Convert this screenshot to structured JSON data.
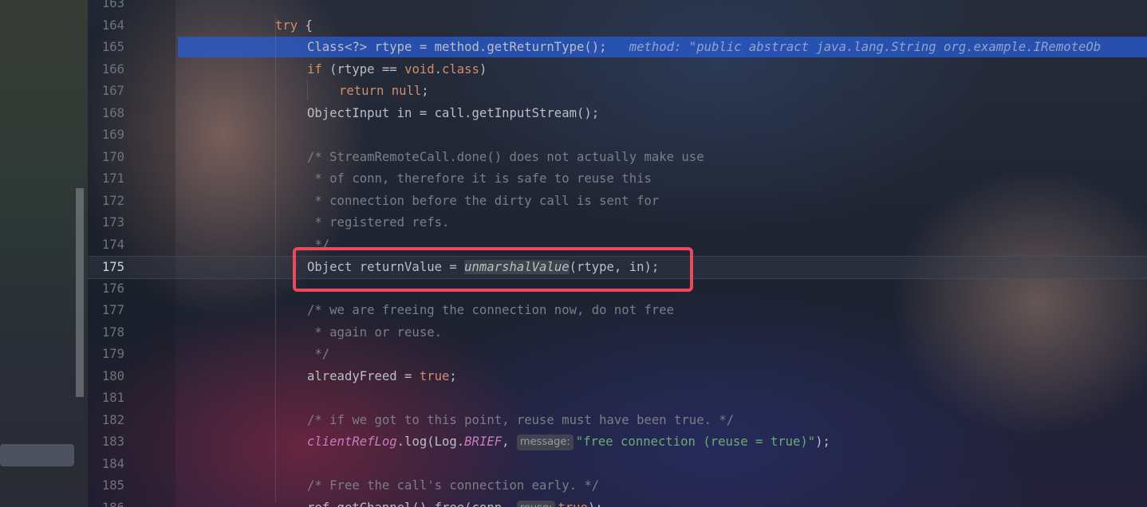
{
  "editor": {
    "lines": [
      {
        "num": "163",
        "tokens": []
      },
      {
        "num": "164",
        "tokens": [
          {
            "t": "try",
            "c": "kw"
          },
          {
            "t": " {",
            "c": ""
          }
        ]
      },
      {
        "num": "165",
        "tokens": [
          {
            "t": "Class<?> rtype = method.getReturnType();",
            "c": ""
          },
          {
            "t": "   method: \"public abstract java.lang.String org.example.IRemoteOb",
            "c": "inline-hint"
          }
        ]
      },
      {
        "num": "166",
        "tokens": [
          {
            "t": "if",
            "c": "kw"
          },
          {
            "t": " (rtype == ",
            "c": ""
          },
          {
            "t": "void",
            "c": "kw"
          },
          {
            "t": ".",
            "c": ""
          },
          {
            "t": "class",
            "c": "kw"
          },
          {
            "t": ")",
            "c": ""
          }
        ]
      },
      {
        "num": "167",
        "tokens": [
          {
            "t": "return",
            "c": "kw"
          },
          {
            "t": " ",
            "c": ""
          },
          {
            "t": "null",
            "c": "kw"
          },
          {
            "t": ";",
            "c": ""
          }
        ]
      },
      {
        "num": "168",
        "tokens": [
          {
            "t": "ObjectInput in = call.getInputStream();",
            "c": ""
          }
        ]
      },
      {
        "num": "169",
        "tokens": []
      },
      {
        "num": "170",
        "tokens": [
          {
            "t": "/* StreamRemoteCall.done() does not actually make use",
            "c": "cm"
          }
        ]
      },
      {
        "num": "171",
        "tokens": [
          {
            "t": " * of conn, therefore it is safe to reuse this",
            "c": "cm"
          }
        ]
      },
      {
        "num": "172",
        "tokens": [
          {
            "t": " * connection before the dirty call is sent for",
            "c": "cm"
          }
        ]
      },
      {
        "num": "173",
        "tokens": [
          {
            "t": " * registered refs.",
            "c": "cm"
          }
        ]
      },
      {
        "num": "174",
        "tokens": [
          {
            "t": " */",
            "c": "cm"
          }
        ]
      },
      {
        "num": "175",
        "tokens": [
          {
            "t": "Object returnValue = ",
            "c": ""
          },
          {
            "t": "unmarshalValue",
            "c": "ital call-hl"
          },
          {
            "t": "(rtype, in);",
            "c": ""
          }
        ]
      },
      {
        "num": "176",
        "tokens": []
      },
      {
        "num": "177",
        "tokens": [
          {
            "t": "/* we are freeing the connection now, do not free",
            "c": "cm"
          }
        ]
      },
      {
        "num": "178",
        "tokens": [
          {
            "t": " * again or reuse.",
            "c": "cm"
          }
        ]
      },
      {
        "num": "179",
        "tokens": [
          {
            "t": " */",
            "c": "cm"
          }
        ]
      },
      {
        "num": "180",
        "tokens": [
          {
            "t": "alreadyFreed = ",
            "c": ""
          },
          {
            "t": "true",
            "c": "kw"
          },
          {
            "t": ";",
            "c": ""
          }
        ]
      },
      {
        "num": "181",
        "tokens": []
      },
      {
        "num": "182",
        "tokens": [
          {
            "t": "/* if we got to this point, reuse must have been true. */",
            "c": "cm"
          }
        ]
      },
      {
        "num": "183",
        "tokens": [
          {
            "t": "clientRefLog",
            "c": "fld"
          },
          {
            "t": ".log(Log.",
            "c": ""
          },
          {
            "t": "BRIEF",
            "c": "fld"
          },
          {
            "t": ", ",
            "c": ""
          },
          {
            "t": "message:",
            "c": "param-hint"
          },
          {
            "t": "\"free connection (reuse = true)\"",
            "c": "str"
          },
          {
            "t": ");",
            "c": ""
          }
        ]
      },
      {
        "num": "184",
        "tokens": []
      },
      {
        "num": "185",
        "tokens": [
          {
            "t": "/* Free the call's connection early. */",
            "c": "cm"
          }
        ]
      },
      {
        "num": "186",
        "tokens": [
          {
            "t": "ref.getChannel().free(conn, ",
            "c": ""
          },
          {
            "t": "reuse:",
            "c": "param-hint"
          },
          {
            "t": "true",
            "c": "kw"
          },
          {
            "t": ");",
            "c": ""
          }
        ]
      }
    ],
    "current_line": "175",
    "execution_line": "165"
  }
}
